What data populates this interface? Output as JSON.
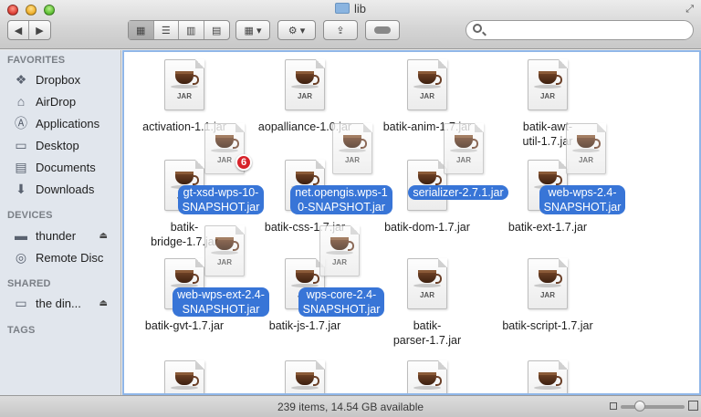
{
  "window": {
    "title": "lib"
  },
  "toolbar": {
    "back_icon": "chevron-left-icon",
    "forward_icon": "chevron-right-icon",
    "view_modes": [
      "icon-view",
      "list-view",
      "column-view",
      "coverflow-view"
    ],
    "active_view": "icon-view",
    "arrange_icon": "arrange-grid-icon",
    "action_icon": "gear-icon",
    "share_icon": "share-icon",
    "tag_icon": "tag-icon",
    "search_placeholder": ""
  },
  "sidebar": {
    "favorites_header": "FAVORITES",
    "favorites": [
      {
        "label": "Dropbox",
        "icon": "dropbox-icon"
      },
      {
        "label": "AirDrop",
        "icon": "airdrop-icon"
      },
      {
        "label": "Applications",
        "icon": "applications-icon"
      },
      {
        "label": "Desktop",
        "icon": "desktop-icon"
      },
      {
        "label": "Documents",
        "icon": "documents-icon"
      },
      {
        "label": "Downloads",
        "icon": "downloads-icon"
      }
    ],
    "devices_header": "DEVICES",
    "devices": [
      {
        "label": "thunder",
        "icon": "hard-drive-icon"
      },
      {
        "label": "Remote Disc",
        "icon": "disc-icon"
      }
    ],
    "shared_header": "SHARED",
    "shared": [
      {
        "label": "the din...",
        "icon": "network-computer-icon"
      }
    ],
    "tags_header": "TAGS"
  },
  "files": [
    {
      "name": "activation-1.1.jar"
    },
    {
      "name": "aopalliance-1.0.jar"
    },
    {
      "name": "batik-anim-1.7.jar"
    },
    {
      "name": "batik-awt-\nutil-1.7.jar"
    },
    {
      "name": "batik-\nbridge-1.7.jar"
    },
    {
      "name": "batik-css-1.7.jar"
    },
    {
      "name": "batik-dom-1.7.jar"
    },
    {
      "name": "batik-ext-1.7.jar"
    },
    {
      "name": "batik-gvt-1.7.jar"
    },
    {
      "name": "batik-js-1.7.jar"
    },
    {
      "name": "batik-\nparser-1.7.jar"
    },
    {
      "name": "batik-script-1.7.jar"
    }
  ],
  "dragged": [
    {
      "name": "gt-xsd-wps-10-\nSNAPSHOT.jar"
    },
    {
      "name": "net.opengis.wps-1\n0-SNAPSHOT.jar"
    },
    {
      "name": "serializer-2.7.1.jar"
    },
    {
      "name": "web-wps-2.4-\nSNAPSHOT.jar"
    },
    {
      "name": "web-wps-ext-2.4-\nSNAPSHOT.jar"
    },
    {
      "name": "wps-core-2.4-\nSNAPSHOT.jar"
    }
  ],
  "drag_badge": "6",
  "icon_label": "JAR",
  "status": {
    "text": "239 items, 14.54 GB available",
    "zoom_level": 0.3
  },
  "colors": {
    "selection": "#3875d7",
    "badge": "#d7222a",
    "sidebar_bg": "#e1e6ed"
  }
}
